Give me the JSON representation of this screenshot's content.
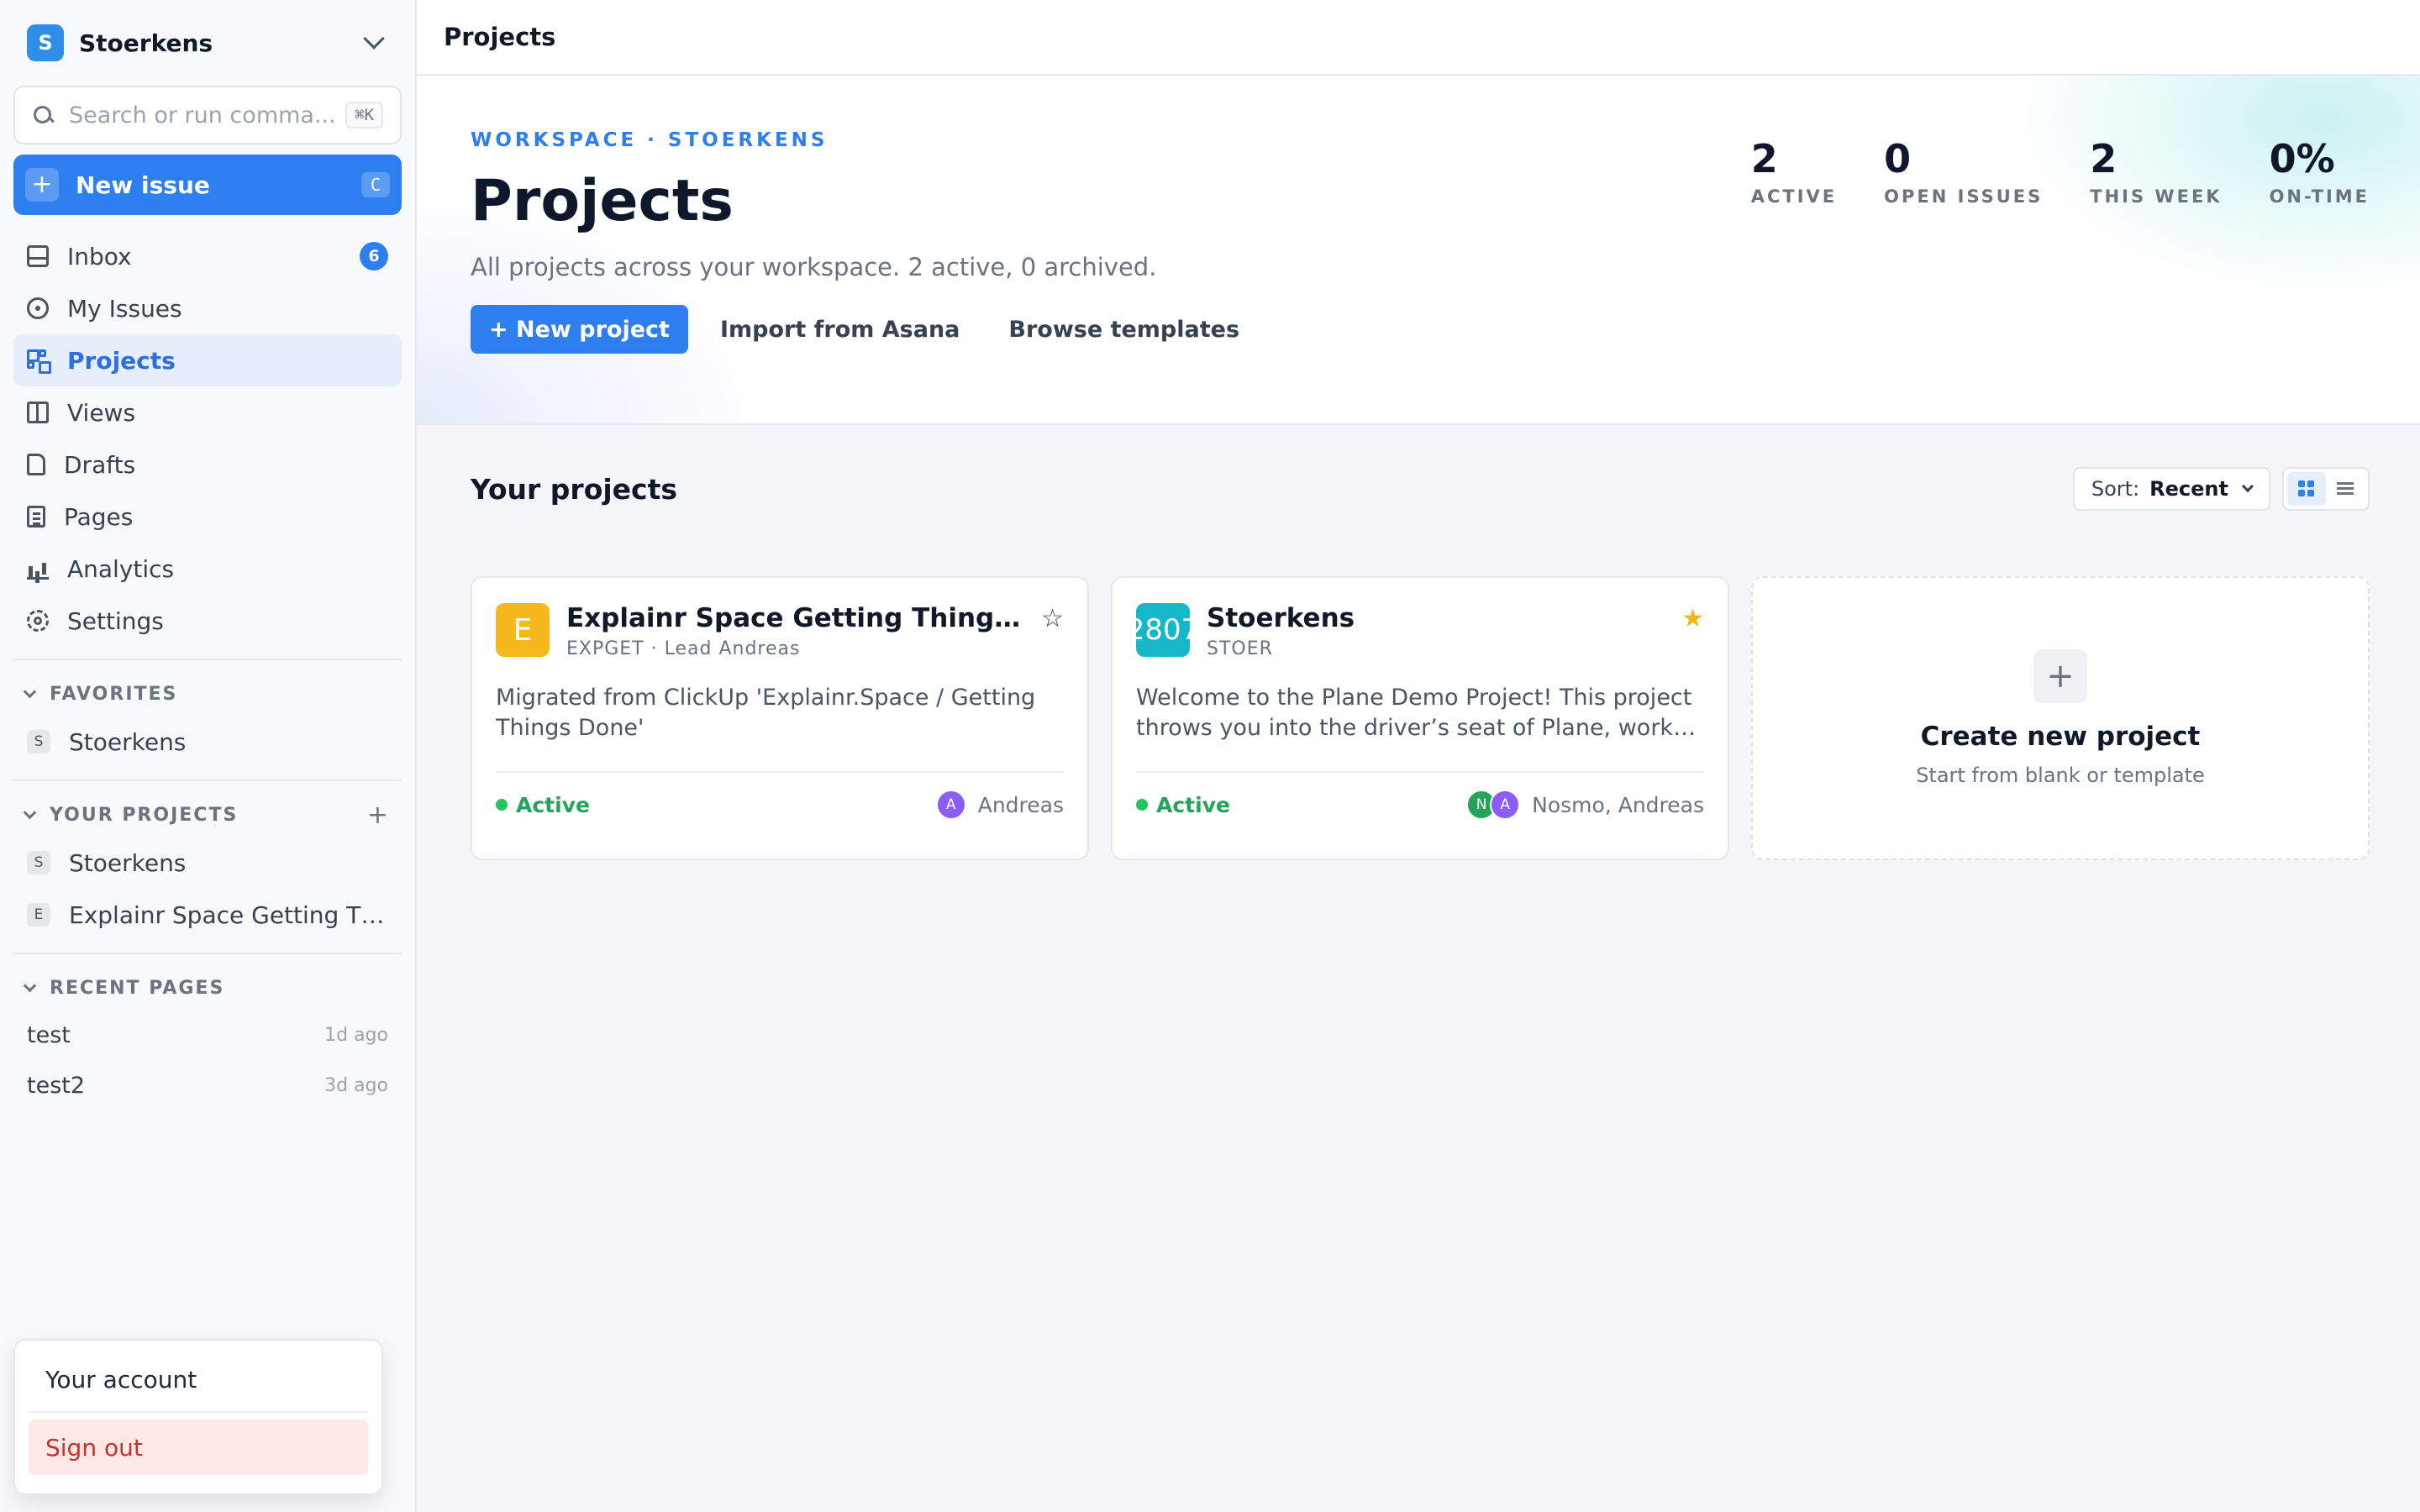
{
  "workspace": {
    "initial": "S",
    "name": "Stoerkens"
  },
  "search": {
    "placeholder": "Search or run comma...",
    "shortcut": "⌘K"
  },
  "new_issue": {
    "label": "New issue",
    "shortcut": "C"
  },
  "nav": {
    "inbox": {
      "label": "Inbox",
      "badge": "6"
    },
    "my_issues": {
      "label": "My Issues"
    },
    "projects": {
      "label": "Projects"
    },
    "views": {
      "label": "Views"
    },
    "drafts": {
      "label": "Drafts"
    },
    "pages": {
      "label": "Pages"
    },
    "analytics": {
      "label": "Analytics"
    },
    "settings": {
      "label": "Settings"
    }
  },
  "favorites": {
    "title": "FAVORITES",
    "items": [
      {
        "initial": "S",
        "label": "Stoerkens"
      }
    ]
  },
  "your_projects": {
    "title": "YOUR PROJECTS",
    "add": "+",
    "items": [
      {
        "initial": "S",
        "label": "Stoerkens"
      },
      {
        "initial": "E",
        "label": "Explainr Space Getting Things Done"
      }
    ]
  },
  "recent_pages": {
    "title": "RECENT PAGES",
    "items": [
      {
        "label": "test",
        "time": "1d ago"
      },
      {
        "label": "test2",
        "time": "3d ago"
      }
    ]
  },
  "account_menu": {
    "account": "Your account",
    "sign_out": "Sign out"
  },
  "topbar": {
    "title": "Projects"
  },
  "hero": {
    "eyebrow": "WORKSPACE · STOERKENS",
    "title": "Projects",
    "subtitle": "All projects across your workspace. 2 active, 0 archived.",
    "actions": {
      "new_project": "+ New project",
      "import": "Import from Asana",
      "templates": "Browse templates"
    },
    "stats": [
      {
        "value": "2",
        "label": "ACTIVE"
      },
      {
        "value": "0",
        "label": "OPEN ISSUES"
      },
      {
        "value": "2",
        "label": "THIS WEEK"
      },
      {
        "value": "0%",
        "label": "ON-TIME"
      }
    ]
  },
  "projects_section": {
    "title": "Your projects",
    "sort_label": "Sort:",
    "sort_value": "Recent"
  },
  "cards": [
    {
      "logo": "E",
      "logo_color": "#f6b81c",
      "title": "Explainr Space Getting Things Done",
      "identifier": "EXPGET",
      "lead": "Lead Andreas",
      "description": "Migrated from ClickUp 'Explainr.Space / Getting Things Done'",
      "status": "Active",
      "members": "Andreas",
      "favorite": false
    },
    {
      "logo": "2807",
      "logo_color": "#15b7c8",
      "title": "Stoerkens",
      "identifier": "STOER",
      "description": "Welcome to the Plane Demo Project! This project throws you into the driver’s seat of Plane, work management software.",
      "status": "Active",
      "members": "Nosmo, Andreas",
      "favorite": true
    }
  ],
  "create_card": {
    "plus": "+",
    "title": "Create new project",
    "subtitle": "Start from blank or template"
  },
  "colors": {
    "accent": "#2d7ff0",
    "success": "#22c55e",
    "star": "#f5b51e",
    "danger_bg": "#fde8e8"
  }
}
